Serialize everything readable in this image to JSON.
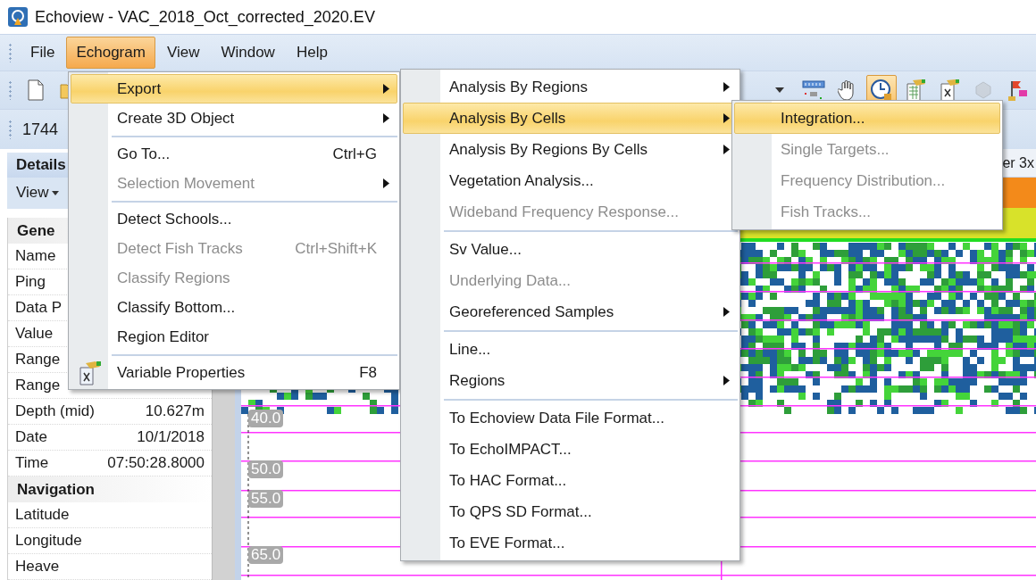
{
  "window": {
    "title": "Echoview - VAC_2018_Oct_corrected_2020.EV"
  },
  "menu_bar": [
    {
      "label": "File",
      "selected": false
    },
    {
      "label": "Echogram",
      "selected": true
    },
    {
      "label": "View",
      "selected": false
    },
    {
      "label": "Window",
      "selected": false
    },
    {
      "label": "Help",
      "selected": false
    }
  ],
  "toolbar": {
    "buttons": [
      {
        "pressed": false,
        "disabled": false
      },
      {
        "pressed": false,
        "disabled": false
      },
      {
        "pressed": false,
        "disabled": false
      },
      {
        "pressed": false,
        "disabled": false
      },
      {
        "pressed": false,
        "disabled": false
      },
      {
        "pressed": true,
        "disabled": false
      },
      {
        "pressed": false,
        "disabled": false
      },
      {
        "pressed": false,
        "disabled": false
      },
      {
        "pressed": false,
        "disabled": true
      },
      {
        "pressed": false,
        "disabled": false
      }
    ]
  },
  "toolbar_2": {
    "text": "1744"
  },
  "details_panel": {
    "title": "Details",
    "view_button": "View",
    "groups": [
      {
        "category": "Gene",
        "rows": [
          {
            "label": "Name"
          },
          {
            "label": "Ping"
          },
          {
            "label": "Data P"
          },
          {
            "label": "Value"
          },
          {
            "label": "Range"
          },
          {
            "label": "Range"
          },
          {
            "label": "Depth (mid)",
            "value": "10.627m"
          },
          {
            "label": "Date",
            "value": "10/1/2018"
          },
          {
            "label": "Time",
            "value": "07:50:28.8000"
          }
        ]
      },
      {
        "category": "Navigation",
        "rows": [
          {
            "label": "Latitude"
          },
          {
            "label": "Longitude"
          },
          {
            "label": "Heave"
          }
        ]
      }
    ]
  },
  "echogram": {
    "header": "er 3x",
    "depth_labels": [
      "40.0",
      "50.0",
      "55.0",
      "65.0"
    ]
  },
  "menus": [
    {
      "items": [
        {
          "kind": "item",
          "label": "Export",
          "submenu": true,
          "disabled": false,
          "selected": true
        },
        {
          "kind": "item",
          "label": "Create 3D Object",
          "submenu": true,
          "disabled": false,
          "selected": false
        },
        {
          "kind": "separator"
        },
        {
          "kind": "item",
          "label": "Go To...",
          "shortcut": "Ctrl+G",
          "submenu": false,
          "disabled": false,
          "selected": false
        },
        {
          "kind": "item",
          "label": "Selection Movement",
          "submenu": true,
          "disabled": true,
          "selected": false
        },
        {
          "kind": "separator"
        },
        {
          "kind": "item",
          "label": "Detect Schools...",
          "submenu": false,
          "disabled": false,
          "selected": false
        },
        {
          "kind": "item",
          "label": "Detect Fish Tracks",
          "shortcut": "Ctrl+Shift+K",
          "submenu": false,
          "disabled": true,
          "selected": false
        },
        {
          "kind": "item",
          "label": "Classify Regions",
          "submenu": false,
          "disabled": true,
          "selected": false
        },
        {
          "kind": "item",
          "label": "Classify Bottom...",
          "submenu": false,
          "disabled": false,
          "selected": false
        },
        {
          "kind": "item",
          "label": "Region Editor",
          "submenu": false,
          "disabled": false,
          "selected": false
        },
        {
          "kind": "separator"
        },
        {
          "kind": "icon_item",
          "label": "Variable Properties",
          "shortcut": "F8",
          "submenu": false,
          "disabled": false,
          "selected": false
        }
      ]
    },
    {
      "items": [
        {
          "kind": "item",
          "label": "Analysis By Regions",
          "submenu": true,
          "disabled": false,
          "selected": false
        },
        {
          "kind": "item",
          "label": "Analysis By Cells",
          "submenu": true,
          "disabled": false,
          "selected": true
        },
        {
          "kind": "item",
          "label": "Analysis By Regions By Cells",
          "submenu": true,
          "disabled": false,
          "selected": false
        },
        {
          "kind": "item",
          "label": "Vegetation Analysis...",
          "submenu": false,
          "disabled": false,
          "selected": false
        },
        {
          "kind": "item",
          "label": "Wideband Frequency Response...",
          "submenu": false,
          "disabled": true,
          "selected": false
        },
        {
          "kind": "separator"
        },
        {
          "kind": "item",
          "label": "Sv Value...",
          "submenu": false,
          "disabled": false,
          "selected": false
        },
        {
          "kind": "item",
          "label": "Underlying Data...",
          "submenu": false,
          "disabled": true,
          "selected": false
        },
        {
          "kind": "item",
          "label": "Georeferenced Samples",
          "submenu": true,
          "disabled": false,
          "selected": false
        },
        {
          "kind": "separator"
        },
        {
          "kind": "item",
          "label": "Line...",
          "submenu": false,
          "disabled": false,
          "selected": false
        },
        {
          "kind": "item",
          "label": "Regions",
          "submenu": true,
          "disabled": false,
          "selected": false
        },
        {
          "kind": "separator"
        },
        {
          "kind": "item",
          "label": "To Echoview Data File Format...",
          "submenu": false,
          "disabled": false,
          "selected": false
        },
        {
          "kind": "item",
          "label": "To EchoIMPACT...",
          "submenu": false,
          "disabled": false,
          "selected": false
        },
        {
          "kind": "item",
          "label": "To HAC Format...",
          "submenu": false,
          "disabled": false,
          "selected": false
        },
        {
          "kind": "item",
          "label": "To QPS SD Format...",
          "submenu": false,
          "disabled": false,
          "selected": false
        },
        {
          "kind": "item",
          "label": "To EVE Format...",
          "submenu": false,
          "disabled": false,
          "selected": false
        }
      ]
    },
    {
      "items": [
        {
          "kind": "item",
          "label": "Integration...",
          "submenu": false,
          "disabled": false,
          "selected": true
        },
        {
          "kind": "item",
          "label": "Single Targets...",
          "submenu": false,
          "disabled": true,
          "selected": false
        },
        {
          "kind": "item",
          "label": "Frequency Distribution...",
          "submenu": false,
          "disabled": true,
          "selected": false
        },
        {
          "kind": "item",
          "label": "Fish Tracks...",
          "submenu": false,
          "disabled": true,
          "selected": false
        }
      ]
    }
  ]
}
